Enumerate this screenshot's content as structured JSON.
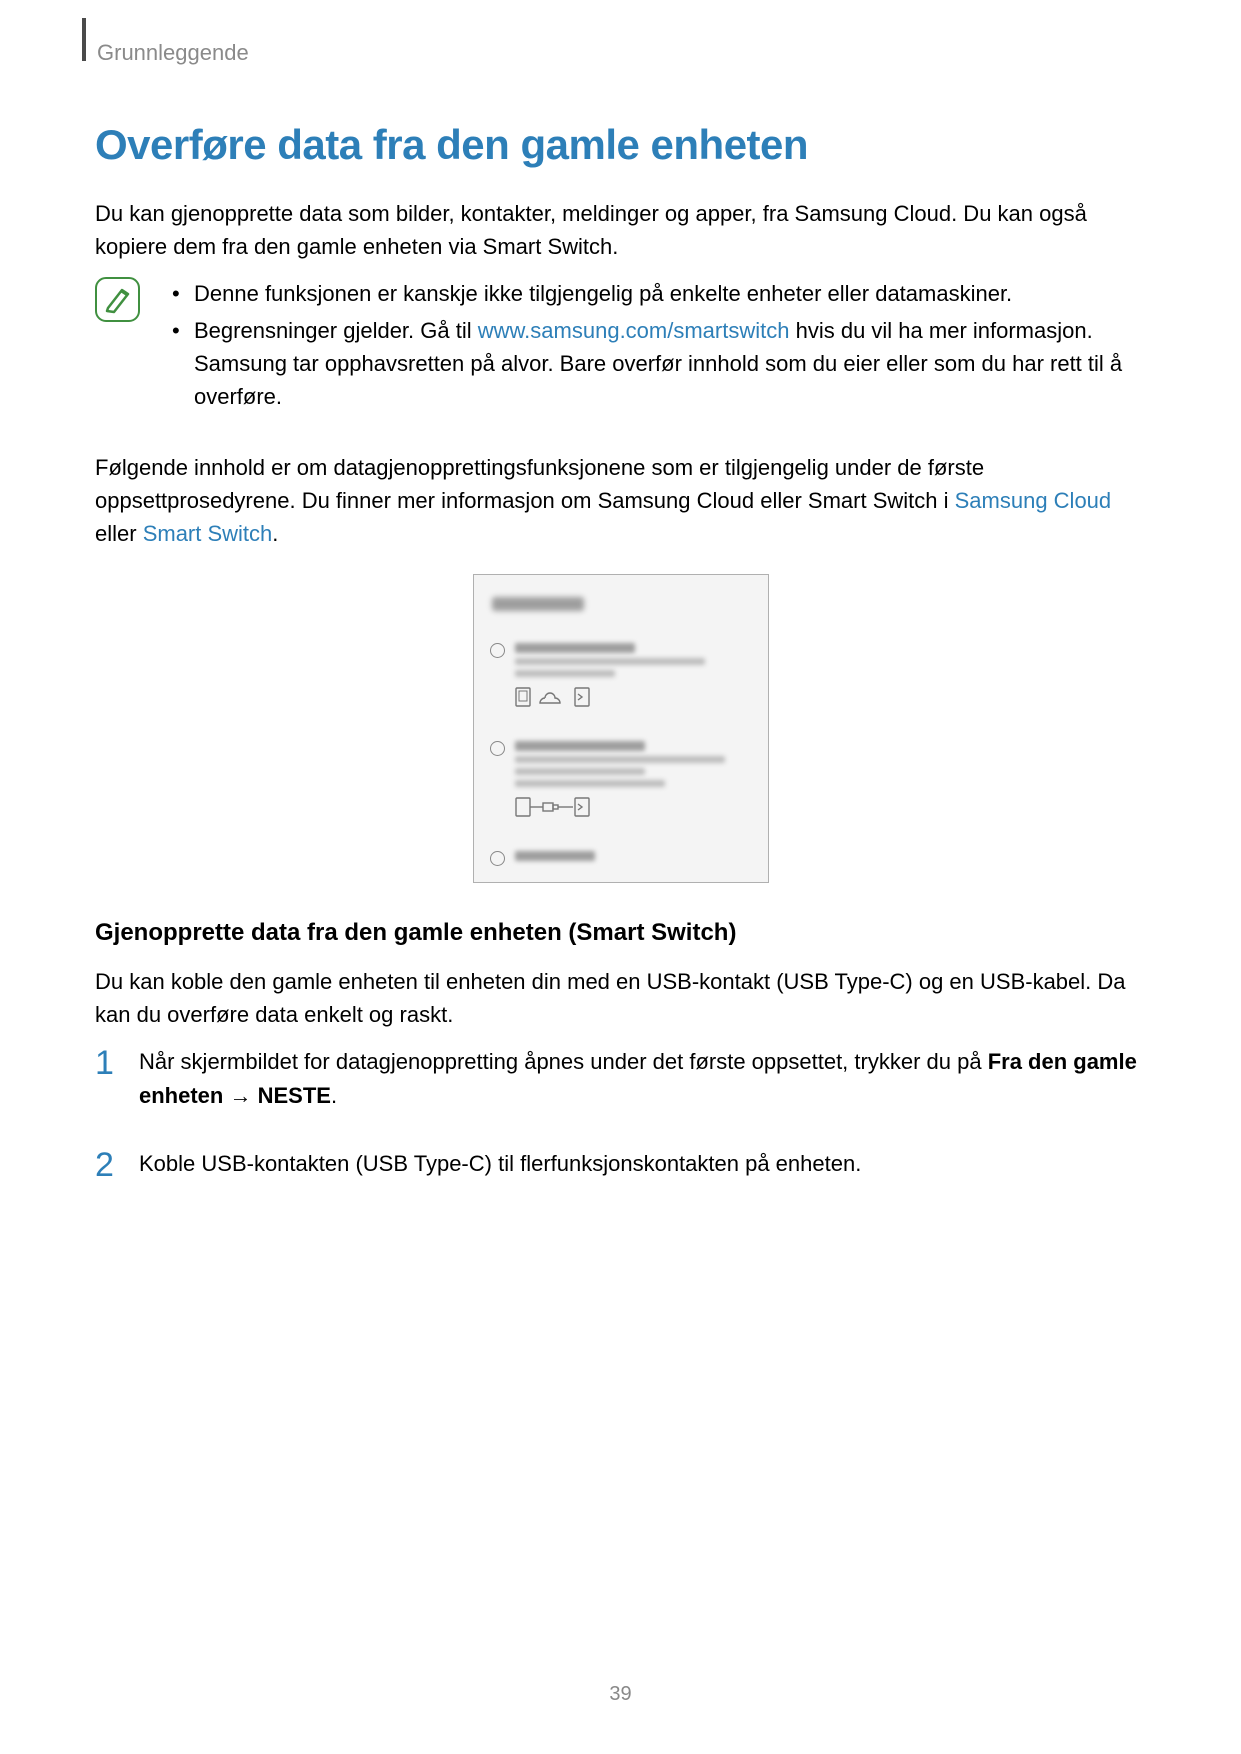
{
  "header": {
    "section": "Grunnleggende"
  },
  "title": "Overføre data fra den gamle enheten",
  "intro": "Du kan gjenopprette data som bilder, kontakter, meldinger og apper, fra Samsung Cloud. Du kan også kopiere dem fra den gamle enheten via Smart Switch.",
  "note": {
    "item1": "Denne funksjonen er kanskje ikke tilgjengelig på enkelte enheter eller datamaskiner.",
    "item2_pre": "Begrensninger gjelder. Gå til ",
    "item2_link": "www.samsung.com/smartswitch",
    "item2_post": " hvis du vil ha mer informasjon. Samsung tar opphavsretten på alvor. Bare overfør innhold som du eier eller som du har rett til å overføre."
  },
  "para2": {
    "pre": "Følgende innhold er om datagjenopprettingsfunksjonene som er tilgjengelig under de første oppsettprosedyrene. Du finner mer informasjon om Samsung Cloud eller Smart Switch i ",
    "link1": "Samsung Cloud",
    "mid": " eller ",
    "link2": "Smart Switch",
    "post": "."
  },
  "subheading": "Gjenopprette data fra den gamle enheten (Smart Switch)",
  "para3": "Du kan koble den gamle enheten til enheten din med en USB-kontakt (USB Type-C) og en USB-kabel. Da kan du overføre data enkelt og raskt.",
  "steps": {
    "s1_pre": "Når skjermbildet for datagjenoppretting åpnes under det første oppsettet, trykker du på ",
    "s1_bold": "Fra den gamle enheten",
    "s1_mid": " → ",
    "s1_bold2": "NESTE",
    "s1_post": ".",
    "s2": "Koble USB-kontakten (USB Type-C) til flerfunksjonskontakten på enheten."
  },
  "page_number": "39"
}
